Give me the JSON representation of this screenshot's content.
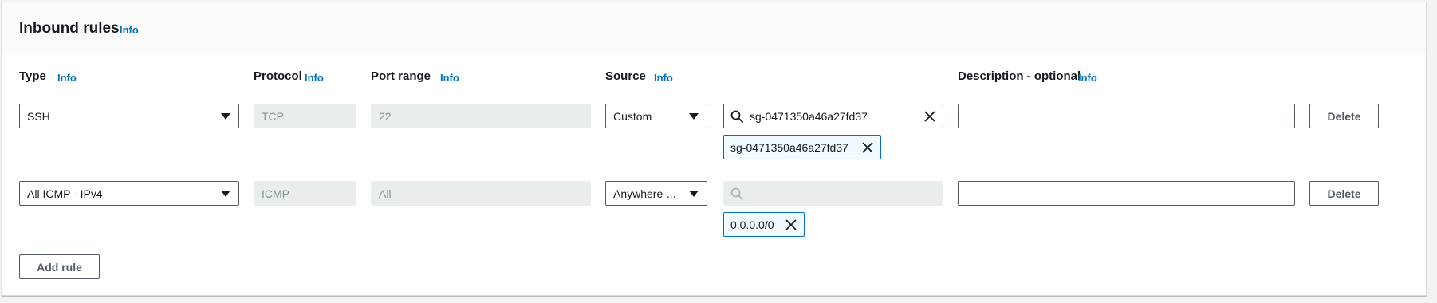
{
  "section": {
    "title": "Inbound rules",
    "info": "Info"
  },
  "columns": {
    "type": {
      "label": "Type",
      "info": "Info"
    },
    "protocol": {
      "label": "Protocol",
      "info": "Info"
    },
    "port_range": {
      "label": "Port range",
      "info": "Info"
    },
    "source": {
      "label": "Source",
      "info": "Info"
    },
    "description": {
      "label": "Description - optional",
      "info": "Info"
    }
  },
  "rules": [
    {
      "type": "SSH",
      "protocol": "TCP",
      "port_range": "22",
      "source_type": "Custom",
      "source_search": "sg-0471350a46a27fd37",
      "source_token": "sg-0471350a46a27fd37",
      "description": "",
      "delete_label": "Delete"
    },
    {
      "type": "All ICMP - IPv4",
      "protocol": "ICMP",
      "port_range": "All",
      "source_type": "Anywhere-...",
      "source_search": "",
      "source_token": "0.0.0.0/0",
      "description": "",
      "delete_label": "Delete"
    }
  ],
  "add_rule_label": "Add rule",
  "icons": {
    "search": "search-icon",
    "clear": "close-icon",
    "remove_token": "close-icon",
    "dropdown": "caret-down-icon"
  },
  "colors": {
    "link": "#0073bb",
    "token_bg": "#f1faff",
    "disabled_bg": "#eaeded",
    "border": "#545b64"
  }
}
